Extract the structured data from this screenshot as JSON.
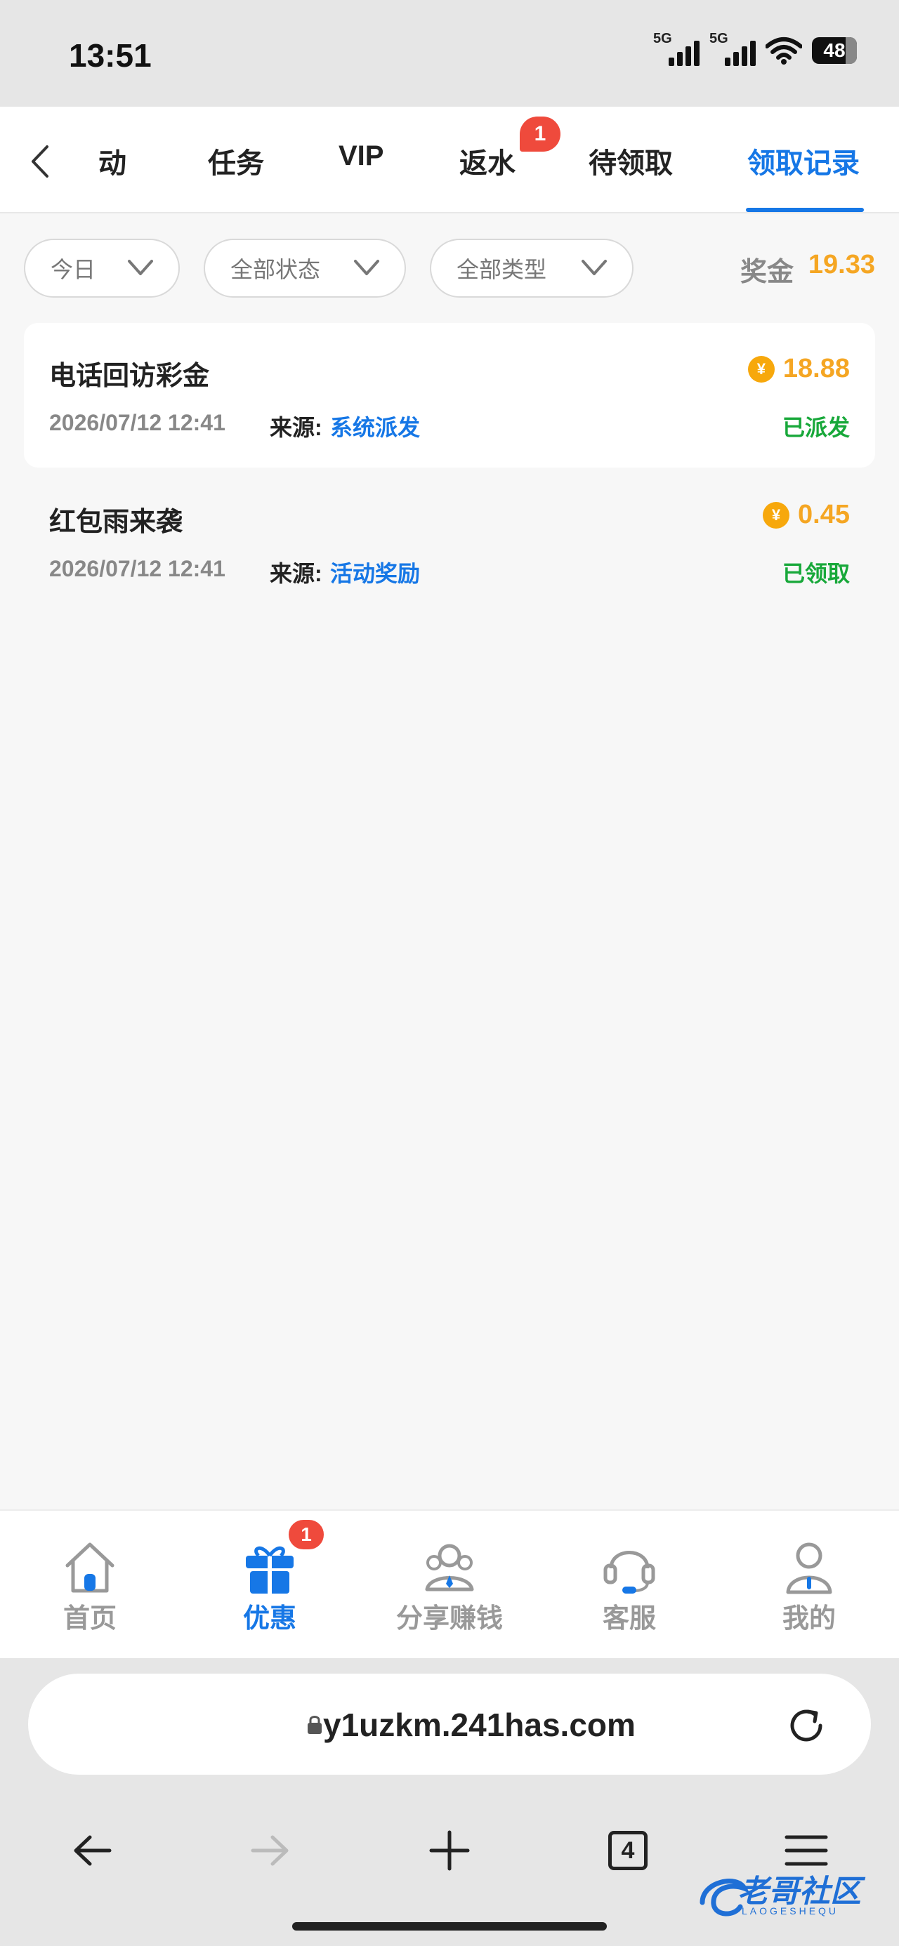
{
  "status_bar": {
    "time": "13:51",
    "signal1": "5G",
    "signal2": "5G",
    "battery": "48"
  },
  "tabs": [
    {
      "label": "动"
    },
    {
      "label": "任务"
    },
    {
      "label": "VIP"
    },
    {
      "label": "返水"
    },
    {
      "label": "待领取"
    },
    {
      "label": "领取记录"
    }
  ],
  "active_tab": "领取记录",
  "tab_badge": "1",
  "filters": {
    "date": "今日",
    "status": "全部状态",
    "type": "全部类型"
  },
  "bonus": {
    "label": "奖金",
    "value": "19.33"
  },
  "records": [
    {
      "title": "电话回访彩金",
      "coin_symbol": "¥",
      "amount": "18.88",
      "date": "2026/07/12 12:41",
      "source_label": "来源:",
      "source": "系统派发",
      "status": "已派发"
    },
    {
      "title": "红包雨来袭",
      "coin_symbol": "¥",
      "amount": "0.45",
      "date": "2026/07/12 12:41",
      "source_label": "来源:",
      "source": "活动奖励",
      "status": "已领取"
    }
  ],
  "bottom_nav": [
    {
      "label": "首页",
      "icon": "home-icon"
    },
    {
      "label": "优惠",
      "icon": "gift-icon"
    },
    {
      "label": "分享赚钱",
      "icon": "share-earn-icon"
    },
    {
      "label": "客服",
      "icon": "headset-icon"
    },
    {
      "label": "我的",
      "icon": "profile-icon"
    }
  ],
  "nav_badge": "1",
  "browser": {
    "url": "y1uzkm.241has.com",
    "tab_count": "4"
  },
  "watermark": {
    "text": "老哥社区",
    "sub": "LAOGESHEQU"
  },
  "colors": {
    "accent": "#1677e6",
    "amount": "#f5a623",
    "success": "#18a83a",
    "badge": "#ef4a3c"
  }
}
